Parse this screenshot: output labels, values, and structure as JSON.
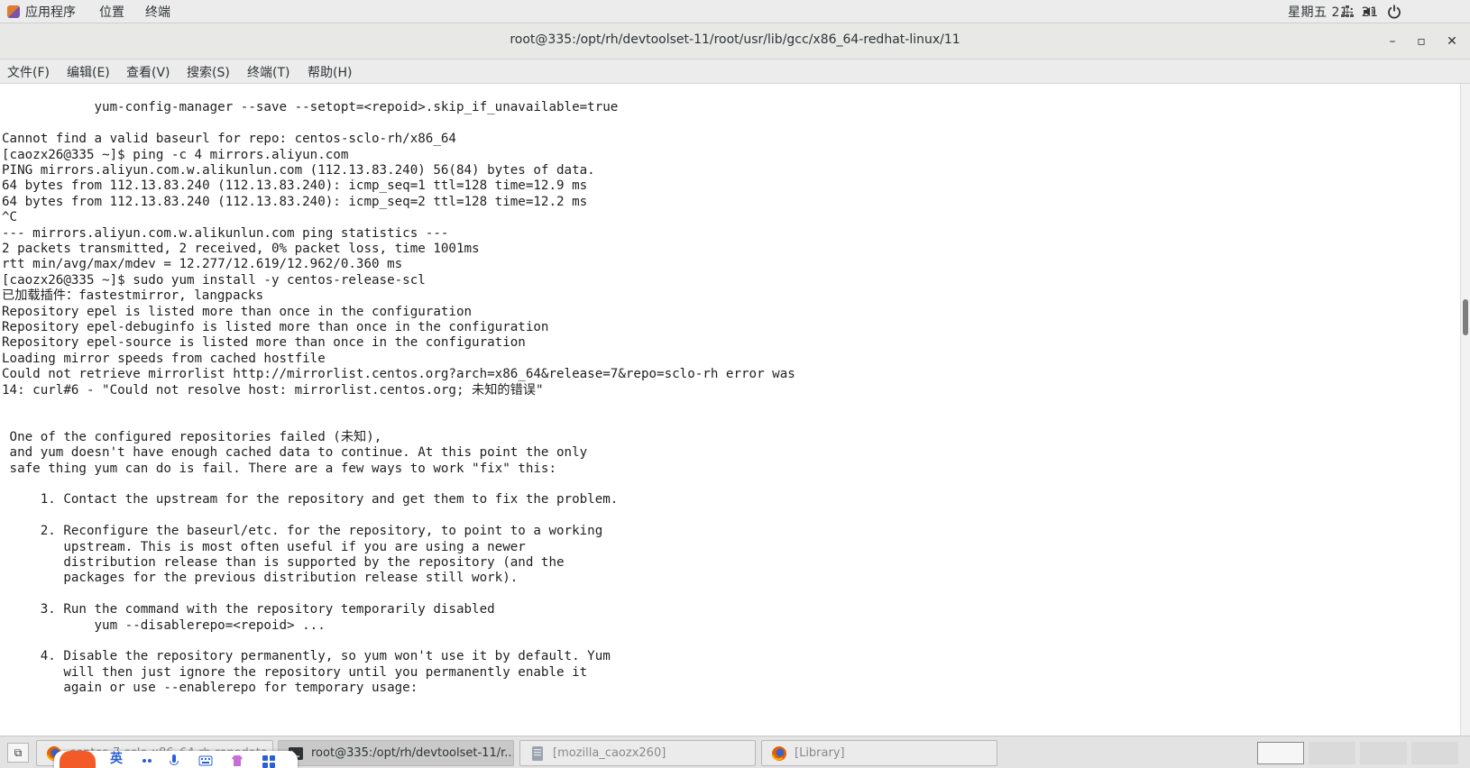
{
  "top_panel": {
    "applications": "应用程序",
    "places": "位置",
    "terminal": "终端",
    "clock": "星期五 21：21"
  },
  "window": {
    "title": "root@335:/opt/rh/devtoolset-11/root/usr/lib/gcc/x86_64-redhat-linux/11",
    "minimize": "–",
    "maximize": "▫",
    "close": "✕"
  },
  "menu": {
    "file": "文件(F)",
    "edit": "编辑(E)",
    "view": "查看(V)",
    "search": "搜索(S)",
    "terminal": "终端(T)",
    "help": "帮助(H)"
  },
  "terminal_lines": [
    "",
    "            yum-config-manager --save --setopt=<repoid>.skip_if_unavailable=true",
    "",
    "Cannot find a valid baseurl for repo: centos-sclo-rh/x86_64",
    "[caozx26@335 ~]$ ping -c 4 mirrors.aliyun.com",
    "PING mirrors.aliyun.com.w.alikunlun.com (112.13.83.240) 56(84) bytes of data.",
    "64 bytes from 112.13.83.240 (112.13.83.240): icmp_seq=1 ttl=128 time=12.9 ms",
    "64 bytes from 112.13.83.240 (112.13.83.240): icmp_seq=2 ttl=128 time=12.2 ms",
    "^C",
    "--- mirrors.aliyun.com.w.alikunlun.com ping statistics ---",
    "2 packets transmitted, 2 received, 0% packet loss, time 1001ms",
    "rtt min/avg/max/mdev = 12.277/12.619/12.962/0.360 ms",
    "[caozx26@335 ~]$ sudo yum install -y centos-release-scl",
    "已加载插件：fastestmirror, langpacks",
    "Repository epel is listed more than once in the configuration",
    "Repository epel-debuginfo is listed more than once in the configuration",
    "Repository epel-source is listed more than once in the configuration",
    "Loading mirror speeds from cached hostfile",
    "Could not retrieve mirrorlist http://mirrorlist.centos.org?arch=x86_64&release=7&repo=sclo-rh error was",
    "14: curl#6 - \"Could not resolve host: mirrorlist.centos.org; 未知的错误\"",
    "",
    "",
    " One of the configured repositories failed (未知),",
    " and yum doesn't have enough cached data to continue. At this point the only",
    " safe thing yum can do is fail. There are a few ways to work \"fix\" this:",
    "",
    "     1. Contact the upstream for the repository and get them to fix the problem.",
    "",
    "     2. Reconfigure the baseurl/etc. for the repository, to point to a working",
    "        upstream. This is most often useful if you are using a newer",
    "        distribution release than is supported by the repository (and the",
    "        packages for the previous distribution release still work).",
    "",
    "     3. Run the command with the repository temporarily disabled",
    "            yum --disablerepo=<repoid> ...",
    "",
    "     4. Disable the repository permanently, so yum won't use it by default. Yum",
    "        will then just ignore the repository until you permanently enable it",
    "        again or use --enablerepo for temporary usage:"
  ],
  "scrollbar_position": 0.35,
  "taskbar": {
    "show_desktop_icon": "show-desktop-icon",
    "tasks": [
      {
        "label": "centos-7-sclo-x86_64-rh-repodata",
        "icon": "firefox-icon",
        "active": false
      },
      {
        "label": "root@335:/opt/rh/devtoolset-11/r...",
        "icon": "terminal-icon",
        "active": true
      },
      {
        "label": "[mozilla_caozx260]",
        "icon": "file-manager-icon",
        "active": false
      },
      {
        "label": "[Library]",
        "icon": "firefox-icon",
        "active": false
      }
    ],
    "workspaces_active": 1
  },
  "ime": {
    "lang": "英"
  },
  "colors": {
    "panel_bg": "#ececec",
    "terminal_bg": "#ffffff",
    "terminal_fg": "#1e1e1e",
    "taskbar_bg": "#e3e3e3",
    "ime_brand": "#f25a28"
  }
}
